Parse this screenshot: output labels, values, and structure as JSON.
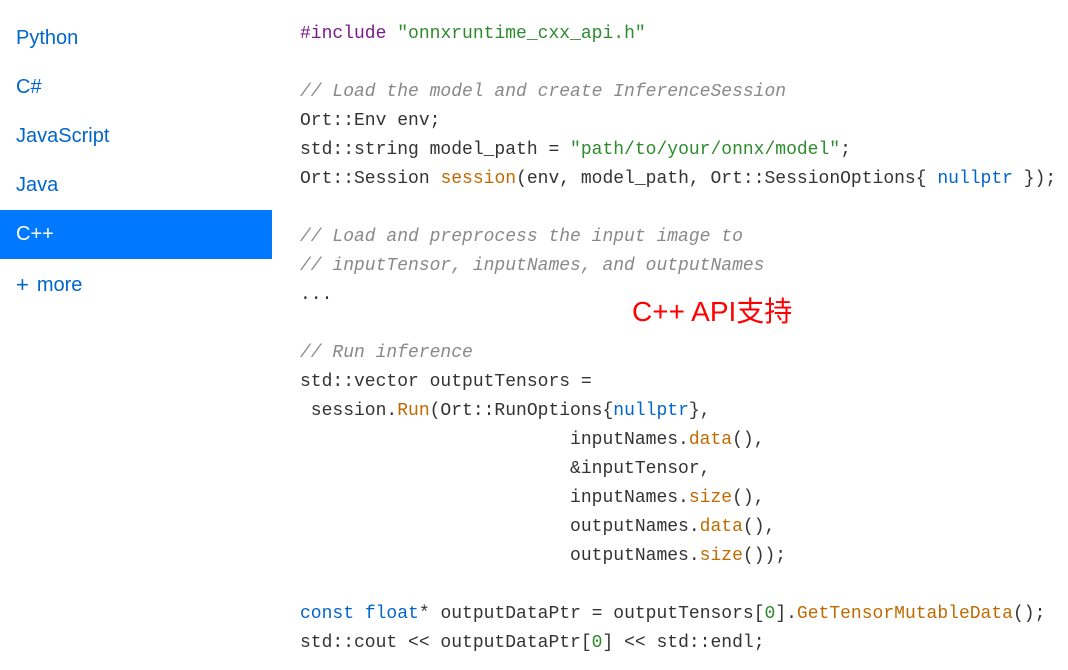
{
  "sidebar": {
    "items": [
      {
        "label": "Python",
        "active": false
      },
      {
        "label": "C#",
        "active": false
      },
      {
        "label": "JavaScript",
        "active": false
      },
      {
        "label": "Java",
        "active": false
      },
      {
        "label": "C++",
        "active": true
      }
    ],
    "more_label": "more"
  },
  "code": {
    "line1_include": "#include",
    "line1_header": "\"onnxruntime_cxx_api.h\"",
    "comment_load_model": "// Load the model and create InferenceSession",
    "line_env": "Ort::Env env;",
    "line_modelpath_pre": "std::string model_path = ",
    "line_modelpath_str": "\"path/to/your/onnx/model\"",
    "line_modelpath_post": ";",
    "line_session_pre": "Ort::Session ",
    "line_session_func": "session",
    "line_session_mid": "(env, model_path, Ort::SessionOptions{ ",
    "line_session_kw": "nullptr",
    "line_session_post": " });",
    "comment_preprocess1": "// Load and preprocess the input image to",
    "comment_preprocess2": "// inputTensor, inputNames, and outputNames",
    "ellipsis": "...",
    "comment_run": "// Run inference",
    "line_vec": "std::vector outputTensors =",
    "line_run_pre": " session.",
    "line_run_func": "Run",
    "line_run_mid": "(Ort::RunOptions{",
    "line_run_kw": "nullptr",
    "line_run_post": "},",
    "line_in_data_pre": "                         inputNames.",
    "line_in_data_func": "data",
    "line_in_data_post": "(),",
    "line_intensor": "                         &inputTensor,",
    "line_in_size_pre": "                         inputNames.",
    "line_in_size_func": "size",
    "line_in_size_post": "(),",
    "line_out_data_pre": "                         outputNames.",
    "line_out_data_func": "data",
    "line_out_data_post": "(),",
    "line_out_size_pre": "                         outputNames.",
    "line_out_size_func": "size",
    "line_out_size_post": "());",
    "line_const_kw1": "const",
    "line_const_kw2": "float",
    "line_const_mid": "* outputDataPtr = outputTensors[",
    "line_const_idx": "0",
    "line_const_mid2": "].",
    "line_const_func": "GetTensorMutableData",
    "line_const_post": "();",
    "line_cout_pre": "std::cout << outputDataPtr[",
    "line_cout_idx": "0",
    "line_cout_post": "] << std::endl;"
  },
  "annotation": "C++ API支持"
}
